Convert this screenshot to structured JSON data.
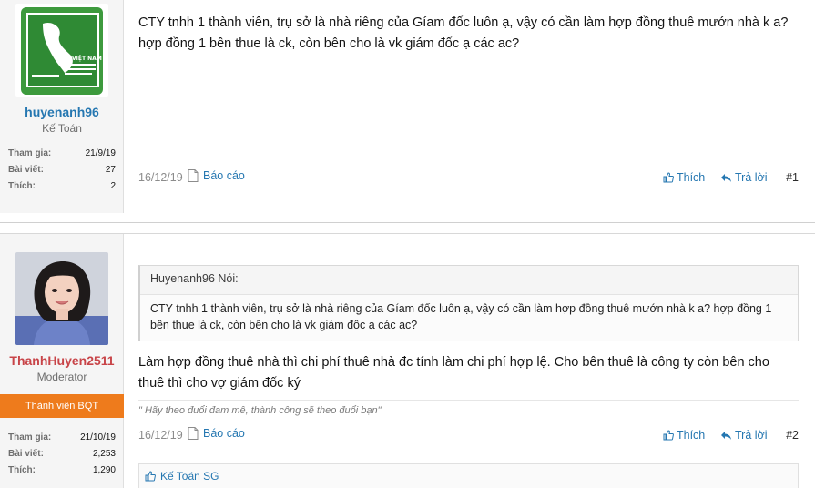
{
  "posts": [
    {
      "username": "huyenanh96",
      "user_title": "Kế Toán",
      "stats": [
        {
          "key": "Tham gia:",
          "value": "21/9/19"
        },
        {
          "key": "Bài viết:",
          "value": "27"
        },
        {
          "key": "Thích:",
          "value": "2"
        }
      ],
      "message": "CTY tnhh 1 thành viên, trụ sở là nhà riêng của Gíam đốc luôn ạ, vậy có cần làm hợp đồng thuê mướn nhà k a? hợp đồng 1 bên thue là ck, còn bên cho là vk giám đốc ạ các ac?",
      "date": "16/12/19",
      "report": "Báo cáo",
      "like": "Thích",
      "reply": "Trả lời",
      "number": "#1"
    },
    {
      "username": "ThanhHuyen2511",
      "user_title": "Moderator",
      "banner": "Thành viên BQT",
      "stats": [
        {
          "key": "Tham gia:",
          "value": "21/10/19"
        },
        {
          "key": "Bài viết:",
          "value": "2,253"
        },
        {
          "key": "Thích:",
          "value": "1,290"
        }
      ],
      "quote_author": "Huyenanh96 Nói:",
      "quote_text": "CTY tnhh 1 thành viên, trụ sở là nhà riêng của Gíam đốc luôn ạ, vậy có cần làm hợp đồng thuê mướn nhà k a? hợp đồng 1 bên thue là ck, còn bên cho là vk giám đốc ạ các ac?",
      "message": "Làm hợp đồng thuê nhà thì chi phí thuê nhà đc tính làm chi phí hợp lệ. Cho bên thuê là công ty còn bên cho thuê thì cho vợ giám đốc ký",
      "signature": "\" Hãy theo đuổi đam mê, thành công sẽ theo đuổi bạn\"",
      "date": "16/12/19",
      "report": "Báo cáo",
      "like": "Thích",
      "reply": "Trả lời",
      "number": "#2",
      "liked_by": "Kế Toán SG"
    }
  ],
  "colors": {
    "link": "#2577b1",
    "moderator_name": "#c84448",
    "banner": "#ee7b1c"
  },
  "icons": {
    "report": "document-icon",
    "like": "thumbs-up-icon",
    "reply": "reply-arrow-icon"
  }
}
